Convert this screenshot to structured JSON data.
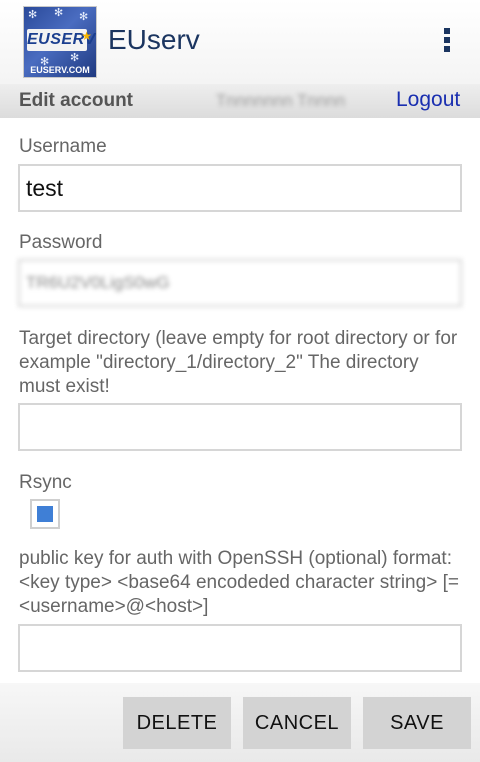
{
  "app": {
    "title": "EUserv",
    "logo": {
      "mark": "EUSERV",
      "url": "EUSERV.COM"
    }
  },
  "header": {
    "title": "Edit account",
    "username_display": "Tnnnnnnn Tnnnn",
    "logout_label": "Logout"
  },
  "form": {
    "username_label": "Username",
    "username_value": "test",
    "password_label": "Password",
    "password_value": "TR6U2V0LigS0wG",
    "target_label": "Target directory (leave empty for root directory or for example \"directory_1/directory_2\" The directory must exist!",
    "target_value": "",
    "rsync_label": "Rsync",
    "rsync_checked": true,
    "pubkey_label": "public key for auth with OpenSSH (optional) format: <key type> <base64 encodeded character string> [= <username>@<host>]",
    "pubkey_value": ""
  },
  "buttons": {
    "delete": "DELETE",
    "cancel": "CANCEL",
    "save": "SAVE"
  },
  "colors": {
    "title": "#1b3560",
    "link": "#1a2fb0",
    "checkbox_fill": "#3f7fd6",
    "button_bg": "#d3d3d3"
  },
  "icons": [
    "app-logo",
    "overflow-menu-icon"
  ]
}
